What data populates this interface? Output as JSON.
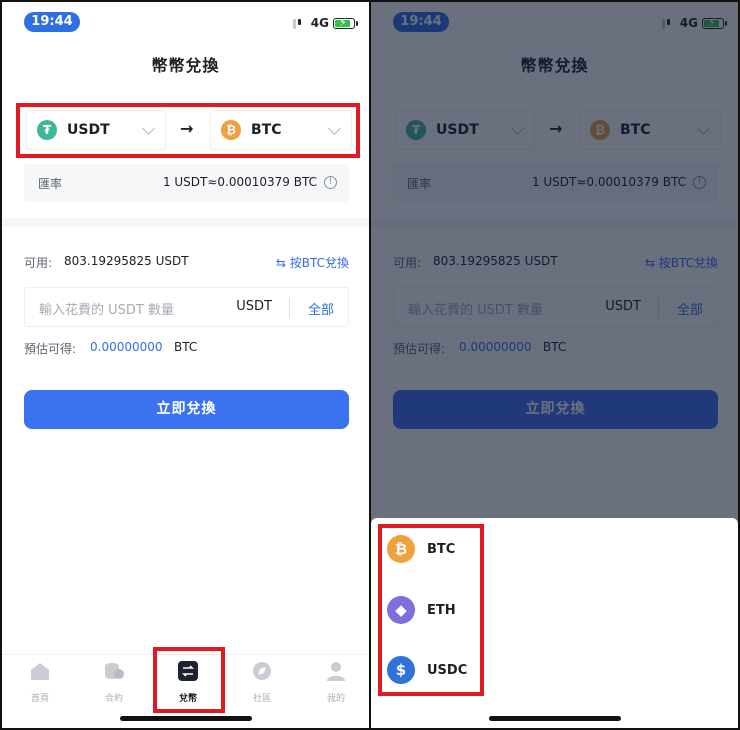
{
  "status": {
    "time": "19:44",
    "network": "4G"
  },
  "page": {
    "title": "幣幣兌換"
  },
  "pair": {
    "from": {
      "symbol": "USDT",
      "icon": "usdt-icon",
      "icon_glyph": "₮"
    },
    "to": {
      "symbol": "BTC",
      "icon": "btc-icon",
      "icon_glyph": "₿"
    },
    "arrow": "→"
  },
  "rate": {
    "label": "匯率",
    "value": "1 USDT≈0.00010379 BTC",
    "info_glyph": "!"
  },
  "available": {
    "label": "可用:",
    "value": "803.19295825 USDT"
  },
  "switch_link": "⇆ 按BTC兌換",
  "amount": {
    "placeholder": "輸入花費的 USDT 數量",
    "unit": "USDT",
    "all": "全部"
  },
  "estimate": {
    "label": "預估可得:",
    "value": "0.00000000",
    "unit": "BTC"
  },
  "cta": "立即兌換",
  "tabs": [
    {
      "label": "首頁",
      "icon": "home-icon"
    },
    {
      "label": "合約",
      "icon": "coins-icon"
    },
    {
      "label": "兌幣",
      "icon": "exchange-icon"
    },
    {
      "label": "社區",
      "icon": "compass-icon"
    },
    {
      "label": "我的",
      "icon": "user-icon"
    }
  ],
  "coin_sheet": {
    "options": [
      {
        "symbol": "BTC",
        "icon": "btc-icon",
        "glyph": "₿"
      },
      {
        "symbol": "ETH",
        "icon": "eth-icon",
        "glyph": "◆"
      },
      {
        "symbol": "USDC",
        "icon": "usdc-icon",
        "glyph": "$"
      }
    ]
  },
  "colors": {
    "accent": "#3a72ef",
    "highlight": "#e01a22",
    "usdt": "#3fb59a",
    "btc": "#f0a03c",
    "eth": "#7d6fdc",
    "usdc": "#2f73d8"
  }
}
